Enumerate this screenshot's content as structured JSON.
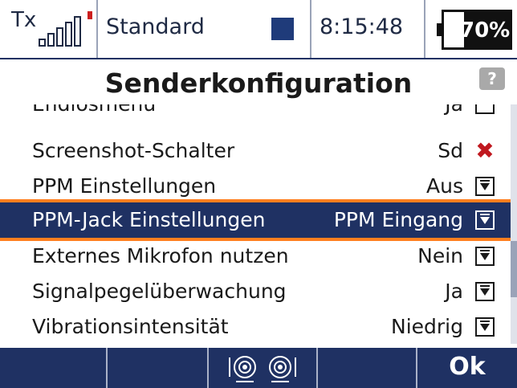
{
  "header": {
    "tx_label": "Tx",
    "model_name": "Standard",
    "model_color": "#1f3b7a",
    "time": "8:15:48",
    "battery_percent": "70%",
    "battery_level": 0.7
  },
  "page": {
    "title": "Senderkonfiguration",
    "help_label": "?"
  },
  "list": {
    "items": [
      {
        "label": "Endlosmenü",
        "value": "Ja",
        "control": "checkbox"
      },
      {
        "label": "Screenshot-Schalter",
        "value": "Sd",
        "control": "x"
      },
      {
        "label": "PPM Einstellungen",
        "value": "Aus",
        "control": "dropdown"
      },
      {
        "label": "PPM-Jack Einstellungen",
        "value": "PPM Eingang",
        "control": "dropdown",
        "selected": true
      },
      {
        "label": "Externes Mikrofon nutzen",
        "value": "Nein",
        "control": "dropdown"
      },
      {
        "label": "Signalpegelüberwachung",
        "value": "Ja",
        "control": "dropdown"
      },
      {
        "label": "Vibrationsintensität",
        "value": "Niedrig",
        "control": "dropdown"
      }
    ]
  },
  "footer": {
    "ok_label": "Ok",
    "trim_icon": "trim-icon"
  },
  "colors": {
    "accent_navy": "#1f3163",
    "highlight_orange": "#ff7f1f",
    "signal_red": "#cc1f1f",
    "x_red": "#c0181f"
  }
}
